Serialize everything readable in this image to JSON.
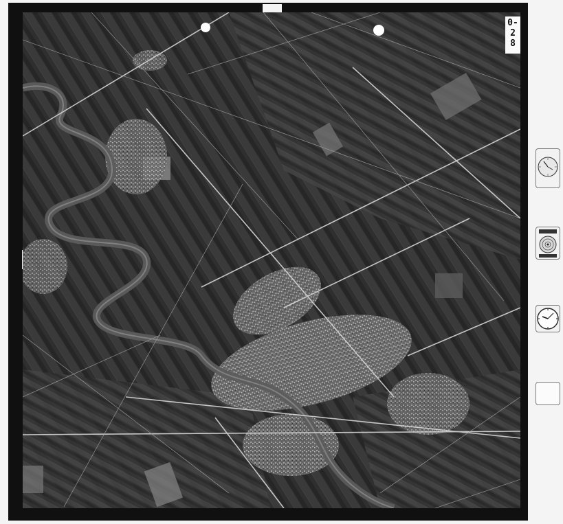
{
  "frame": {
    "number": "0-2 8"
  },
  "photo": {
    "type": "aerial-photograph",
    "colors": {
      "fields_dark": "#2c2c2c",
      "fields_mid": "#4a4a4a",
      "fields_light": "#7a7a7a",
      "river": "#5a5a5a",
      "urban": "#9a9a9a",
      "roads": "#d8d8d8"
    }
  },
  "instruments": {
    "altimeter_icon": "altimeter-dial-icon",
    "level_icon": "bubble-level-icon",
    "clock_icon": "clock-icon",
    "data_card_lines": [
      "",
      "",
      ""
    ]
  }
}
